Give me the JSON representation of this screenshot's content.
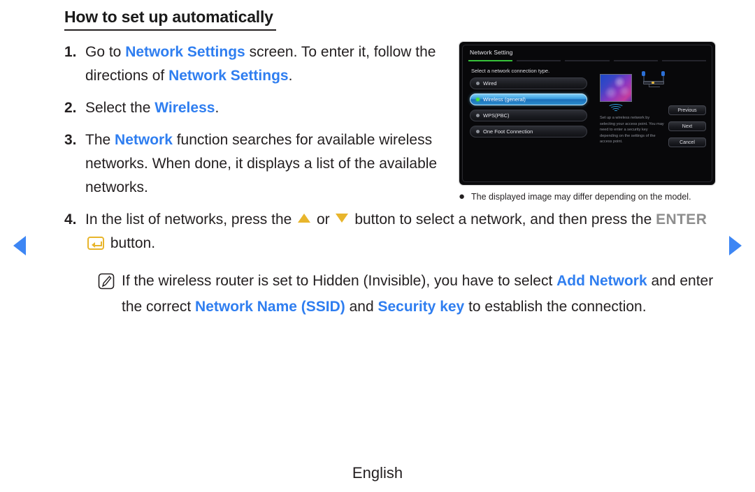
{
  "nav": {
    "prev_icon": "triangle-left-icon",
    "next_icon": "triangle-right-icon",
    "accent": "#3d86f4"
  },
  "heading": "How to set up automatically",
  "steps": [
    {
      "num": "1.",
      "parts": [
        {
          "t": "Go to ",
          "s": "plain"
        },
        {
          "t": "Network Settings",
          "s": "blue"
        },
        {
          "t": " screen. To enter it, follow the directions of ",
          "s": "plain"
        },
        {
          "t": "Network Settings",
          "s": "blue"
        },
        {
          "t": ".",
          "s": "plain"
        }
      ]
    },
    {
      "num": "2.",
      "parts": [
        {
          "t": "Select the ",
          "s": "plain"
        },
        {
          "t": "Wireless",
          "s": "blue"
        },
        {
          "t": ".",
          "s": "plain"
        }
      ]
    },
    {
      "num": "3.",
      "parts": [
        {
          "t": "The ",
          "s": "plain"
        },
        {
          "t": "Network",
          "s": "blue"
        },
        {
          "t": " function searches for available wireless networks. When done, it displays a list of the available networks.",
          "s": "plain"
        }
      ]
    },
    {
      "num": "4.",
      "parts": [
        {
          "t": "In the list of networks, press the ",
          "s": "plain"
        },
        {
          "t": "",
          "s": "tri-up"
        },
        {
          "t": " or ",
          "s": "plain"
        },
        {
          "t": "",
          "s": "tri-down"
        },
        {
          "t": " button to select a network, and then press the ",
          "s": "plain"
        },
        {
          "t": "ENTER",
          "s": "gray-bold"
        },
        {
          "t": "",
          "s": "enter-key"
        },
        {
          "t": " button.",
          "s": "plain"
        }
      ]
    }
  ],
  "note": {
    "icon": "note-pencil-icon",
    "parts": [
      {
        "t": "If the wireless router is set to Hidden (Invisible), you have to select ",
        "s": "plain"
      },
      {
        "t": "Add Network",
        "s": "blue"
      },
      {
        "t": " and enter the correct ",
        "s": "plain"
      },
      {
        "t": "Network Name (SSID)",
        "s": "blue"
      },
      {
        "t": " and ",
        "s": "plain"
      },
      {
        "t": "Security key",
        "s": "blue"
      },
      {
        "t": " to establish the connection.",
        "s": "plain"
      }
    ]
  },
  "tv_screen": {
    "title": "Network Setting",
    "progress_segments": 5,
    "progress_active_index": 1,
    "progress_color": "#37c23a",
    "prompt": "Select a network connection type.",
    "options": [
      {
        "label": "Wired",
        "selected": false
      },
      {
        "label": "Wireless (general)",
        "selected": true
      },
      {
        "label": "WPS(PBC)",
        "selected": false
      },
      {
        "label": "One Foot Connection",
        "selected": false
      }
    ],
    "description": "Set up a wireless network by selecting your access point. You may need to enter a security key depending on the settings of the access point.",
    "buttons": [
      "Previous",
      "Next",
      "Cancel"
    ],
    "illustration": {
      "tv_icon": "television-icon",
      "wifi_icon": "wifi-waves-icon",
      "router_icon": "wireless-router-icon"
    }
  },
  "tv_caption": {
    "bullet": "●",
    "text": "The displayed image may differ depending on the model."
  },
  "footer": "English"
}
